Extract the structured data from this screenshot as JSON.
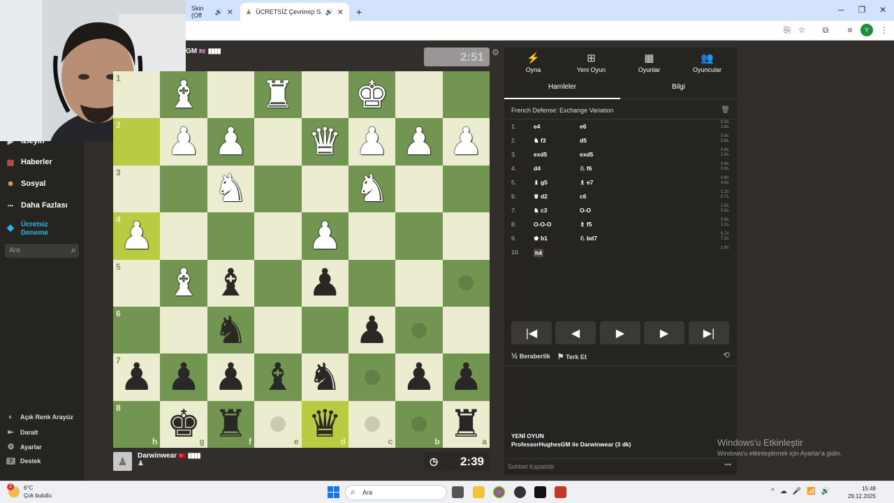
{
  "browser": {
    "tabs": [
      {
        "label": "Skin (Off",
        "active": false
      },
      {
        "label": "ÜCRETSİZ Çevrimiçi Satranç",
        "active": true
      }
    ],
    "new_tab": "+",
    "controls": {
      "minimize": "─",
      "restore": "❐",
      "close": "✕"
    },
    "toolbar_icons": [
      "install-icon",
      "star-icon",
      "extensions-icon",
      "tab-search-icon",
      "profile-icon",
      "menu-icon"
    ],
    "profile_initial": "Y"
  },
  "sidebar": {
    "items": [
      {
        "label": "İzleyin",
        "icon": "▶"
      },
      {
        "label": "Haberler",
        "icon": "▤"
      },
      {
        "label": "Sosyal",
        "icon": "☻"
      },
      {
        "label": "Daha Fazlası",
        "icon": "•••"
      }
    ],
    "premium": {
      "label_1": "Ücretsiz",
      "label_2": "Deneme",
      "icon": "◆",
      "color": "#23b7e5"
    },
    "search_placeholder": "Ara",
    "bottom": [
      {
        "label": "Açık Renk Arayüz",
        "icon": "◐"
      },
      {
        "label": "Daralt",
        "icon": "⇤"
      },
      {
        "label": "Ayarlar",
        "icon": "⚙"
      },
      {
        "label": "Destek",
        "icon": "?"
      }
    ]
  },
  "game": {
    "top_player": {
      "name": "GM",
      "flag": "🇬🇧",
      "clock": "2:51"
    },
    "bottom_player": {
      "name": "Darwinwear",
      "flag": "🇹🇷",
      "clock": "2:39",
      "clock_icon": "◷"
    },
    "board": {
      "ranks_shown": [
        "1",
        "2",
        "3",
        "4",
        "5",
        "6",
        "7",
        "8"
      ],
      "files_shown": [
        "h",
        "g",
        "f",
        "e",
        "d",
        "c",
        "b",
        "a"
      ],
      "light_color": "#ebecd0",
      "dark_color": "#739552",
      "rows": [
        [
          " ",
          "wB",
          " ",
          "wR",
          " ",
          "wK",
          " ",
          " "
        ],
        [
          "hl",
          "wP",
          "wP",
          " ",
          "wQ",
          "wP",
          "wP",
          "wP"
        ],
        [
          " ",
          " ",
          "wN",
          " ",
          " ",
          "wN",
          " ",
          " "
        ],
        [
          "wP",
          " ",
          " ",
          " ",
          "wP",
          " ",
          " ",
          " "
        ],
        [
          " ",
          "wB",
          "bB",
          " ",
          "bP",
          " ",
          " ",
          "."
        ],
        [
          " ",
          " ",
          "bN",
          " ",
          " ",
          "bP",
          ".",
          " "
        ],
        [
          "bP",
          "bP",
          "bP",
          "bB",
          "bN",
          ".",
          "bP",
          "bP"
        ],
        [
          " ",
          "bK",
          "bR",
          ".",
          "bQ",
          ".",
          ".",
          "bR"
        ]
      ]
    }
  },
  "panel": {
    "tabs": [
      {
        "label": "Oyna",
        "icon": "⚡"
      },
      {
        "label": "Yeni Oyun",
        "icon": "⊞"
      },
      {
        "label": "Oyunlar",
        "icon": "▦"
      },
      {
        "label": "Oyuncular",
        "icon": "👥"
      }
    ],
    "subtabs": [
      "Hamleler",
      "Bilgi"
    ],
    "opening": "French Defense: Exchange Variation",
    "moves": [
      {
        "n": "1.",
        "w": "e4",
        "b": "e6",
        "tw": "0.3s",
        "tb": "1.8s"
      },
      {
        "n": "2.",
        "w": "♞ f3",
        "b": "d5",
        "tw": "0.6s",
        "tb": "0.9s"
      },
      {
        "n": "3.",
        "w": "exd5",
        "b": "exd5",
        "tw": "0.8s",
        "tb": "1.0s"
      },
      {
        "n": "4.",
        "w": "d4",
        "b": "♘ f6",
        "tw": "0.4s",
        "tb": "0.5s"
      },
      {
        "n": "5.",
        "w": "♝ g5",
        "b": "♗ e7",
        "tw": "0.8s",
        "tb": "4.9s"
      },
      {
        "n": "6.",
        "w": "♛ d2",
        "b": "c6",
        "tw": "1.2s",
        "tb": "0.7s"
      },
      {
        "n": "7.",
        "w": "♞ c3",
        "b": "O-O",
        "tw": "1.5s",
        "tb": "0.5s"
      },
      {
        "n": "8.",
        "w": "O-O-O",
        "b": "♗ f5",
        "tw": "0.8s",
        "tb": "1.1s"
      },
      {
        "n": "9.",
        "w": "♚ b1",
        "b": "♘ bd7",
        "tw": "0.7s",
        "tb": "7.2s"
      },
      {
        "n": "10.",
        "w": "h4",
        "b": "",
        "tw": "1.8s",
        "tb": ""
      }
    ],
    "nav": [
      "|◀",
      "◀",
      "▶",
      "▶",
      "▶|"
    ],
    "actions": {
      "draw": "Beraberlik",
      "draw_icon": "½",
      "resign": "Terk Et",
      "resign_icon": "⚑",
      "flip_icon": "⟲"
    },
    "new_game": {
      "title": "YENİ OYUN",
      "desc": "ProfessorHughesGM ile Darwinwear (3 dk)"
    },
    "chat": "Sohbet Kapatıldı",
    "chat_more": "•••"
  },
  "watermark": {
    "line1": "Windows'u Etkinleştir",
    "line2": "Windows'u etkinleştirmek için Ayarlar'a gidin."
  },
  "taskbar": {
    "weather": {
      "temp": "6°C",
      "desc": "Çok bulutlu",
      "badge": "2"
    },
    "search_placeholder": "Ara",
    "tray_icons": [
      "^",
      "☁",
      "🎤",
      "📶",
      "🔊"
    ],
    "time": "15:48",
    "date": "29.12.2025"
  }
}
